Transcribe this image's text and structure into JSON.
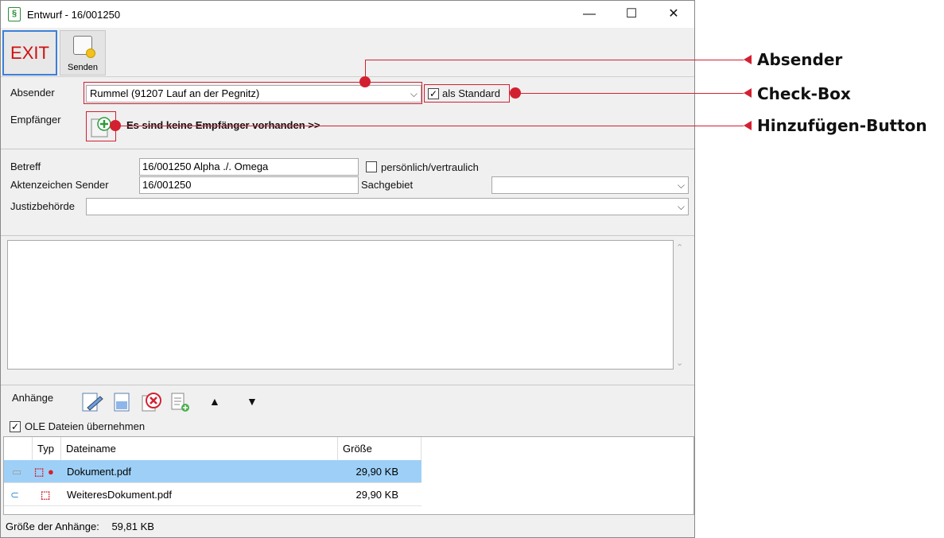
{
  "window": {
    "title": "Entwurf - 16/001250",
    "app_icon_glyph": "§",
    "minimize_glyph": "—",
    "maximize_glyph": "☐",
    "close_glyph": "✕"
  },
  "toolbar": {
    "exit_label": "EXIT",
    "send_label": "Senden"
  },
  "sender": {
    "label": "Absender",
    "value": "Rummel (91207 Lauf an der Pegnitz)",
    "default_label": "als Standard",
    "default_checked": true
  },
  "recipients": {
    "label": "Empfänger",
    "empty_text": "Es sind keine Empfänger vorhanden >>"
  },
  "details": {
    "subject_label": "Betreff",
    "subject_value": "16/001250 Alpha ./. Omega",
    "confidential_label": "persönlich/vertraulich",
    "reference_label": "Aktenzeichen Sender",
    "reference_value": "16/001250",
    "subject_area_label": "Sachgebiet",
    "subject_area_value": "",
    "authority_label": "Justizbehörde",
    "authority_value": ""
  },
  "attachments": {
    "label": "Anhänge",
    "ole_label": "OLE Dateien übernehmen",
    "ole_checked": true,
    "columns": [
      "",
      "Typ",
      "Dateiname",
      "Größe"
    ],
    "rows": [
      {
        "name": "Dokument.pdf",
        "size": "29,90 KB",
        "selected": true
      },
      {
        "name": "WeiteresDokument.pdf",
        "size": "29,90 KB",
        "selected": false
      }
    ],
    "total_label": "Größe der Anhänge:",
    "total_value": "59,81 KB"
  },
  "callouts": {
    "sender": "Absender",
    "checkbox": "Check-Box",
    "add_button": "Hinzufügen-Button"
  },
  "colors": {
    "accent_red": "#d32030",
    "selection_blue": "#9ed0f7",
    "exit_red": "#d01010"
  }
}
